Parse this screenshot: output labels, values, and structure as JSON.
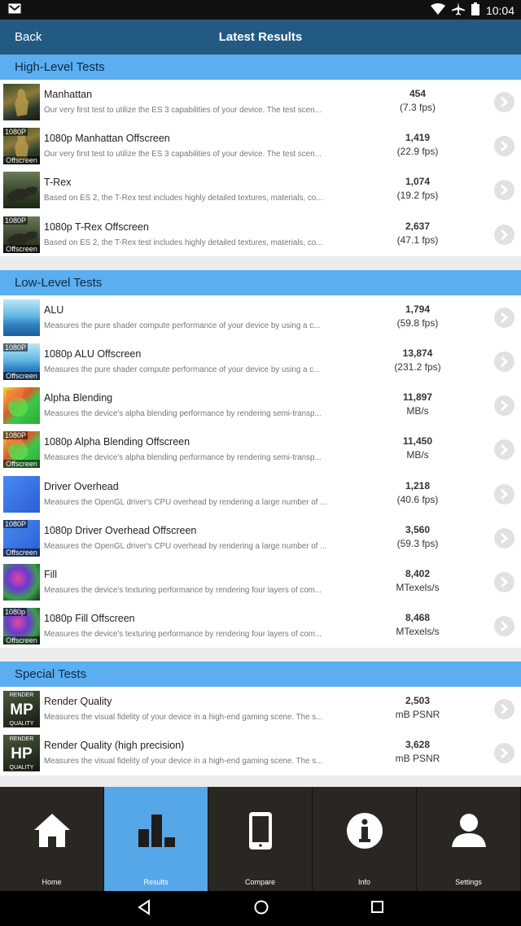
{
  "statusbar": {
    "time": "10:04",
    "icons": [
      "mail-icon",
      "wifi-icon",
      "airplane-icon",
      "battery-icon"
    ]
  },
  "header": {
    "back_label": "Back",
    "title": "Latest Results"
  },
  "sections": [
    {
      "title": "High-Level Tests",
      "items": [
        {
          "name": "Manhattan",
          "desc": "Our very first test to utilize the ES 3 capabilities of your device. The test scen...",
          "score": "454",
          "unit": "(7.3 fps)"
        },
        {
          "name": "1080p Manhattan Offscreen",
          "desc": "Our very first test to utilize the ES 3 capabilities of your device. The test scen...",
          "score": "1,419",
          "unit": "(22.9 fps)"
        },
        {
          "name": "T-Rex",
          "desc": "Based on ES 2, the T-Rex test includes highly detailed textures, materials, co...",
          "score": "1,074",
          "unit": "(19.2 fps)"
        },
        {
          "name": "1080p T-Rex Offscreen",
          "desc": "Based on ES 2, the T-Rex test includes highly detailed textures, materials, co...",
          "score": "2,637",
          "unit": "(47.1 fps)"
        }
      ]
    },
    {
      "title": "Low-Level Tests",
      "items": [
        {
          "name": "ALU",
          "desc": "Measures the pure shader compute performance of your device by using a c...",
          "score": "1,794",
          "unit": "(59.8 fps)"
        },
        {
          "name": "1080p ALU Offscreen",
          "desc": "Measures the pure shader compute performance of your device by using a c...",
          "score": "13,874",
          "unit": "(231.2 fps)"
        },
        {
          "name": "Alpha Blending",
          "desc": "Measures the device's alpha blending performance by rendering semi-transp...",
          "score": "11,897",
          "unit": "MB/s"
        },
        {
          "name": "1080p Alpha Blending Offscreen",
          "desc": "Measures the device's alpha blending performance by rendering semi-transp...",
          "score": "11,450",
          "unit": "MB/s"
        },
        {
          "name": "Driver Overhead",
          "desc": "Measures the OpenGL driver's CPU overhead by rendering a large number of ...",
          "score": "1,218",
          "unit": "(40.6 fps)"
        },
        {
          "name": "1080p Driver Overhead Offscreen",
          "desc": "Measures the OpenGL driver's CPU overhead by rendering a large number of ...",
          "score": "3,560",
          "unit": "(59.3 fps)"
        },
        {
          "name": "Fill",
          "desc": "Measures the device's texturing performance by rendering four layers of com...",
          "score": "8,402",
          "unit": "MTexels/s"
        },
        {
          "name": "1080p Fill Offscreen",
          "desc": "Measures the device's texturing performance by rendering four layers of com...",
          "score": "8,468",
          "unit": "MTexels/s"
        }
      ]
    },
    {
      "title": "Special Tests",
      "items": [
        {
          "name": "Render Quality",
          "desc": "Measures the visual fidelity of your device in a high-end gaming scene. The s...",
          "score": "2,503",
          "unit": "mB PSNR"
        },
        {
          "name": "Render Quality (high precision)",
          "desc": "Measures the visual fidelity of your device in a high-end gaming scene. The s...",
          "score": "3,628",
          "unit": "mB PSNR"
        }
      ]
    }
  ],
  "thumb_tags": {
    "offscreen_top": "1080P",
    "offscreen_top_fill": "1080p",
    "offscreen_bottom": "Offscreen",
    "render_top": "RENDER",
    "render_bottom": "QUALITY",
    "mp": "MP",
    "hp": "HP"
  },
  "bottom_nav": [
    {
      "label": "Home",
      "icon": "home-icon"
    },
    {
      "label": "Results",
      "icon": "results-icon",
      "active": true
    },
    {
      "label": "Compare",
      "icon": "phone-icon"
    },
    {
      "label": "Info",
      "icon": "info-icon"
    },
    {
      "label": "Settings",
      "icon": "user-icon"
    }
  ],
  "colors": {
    "accent": "#5baeef",
    "header": "#235a82",
    "nav_bg": "#2a2622"
  }
}
